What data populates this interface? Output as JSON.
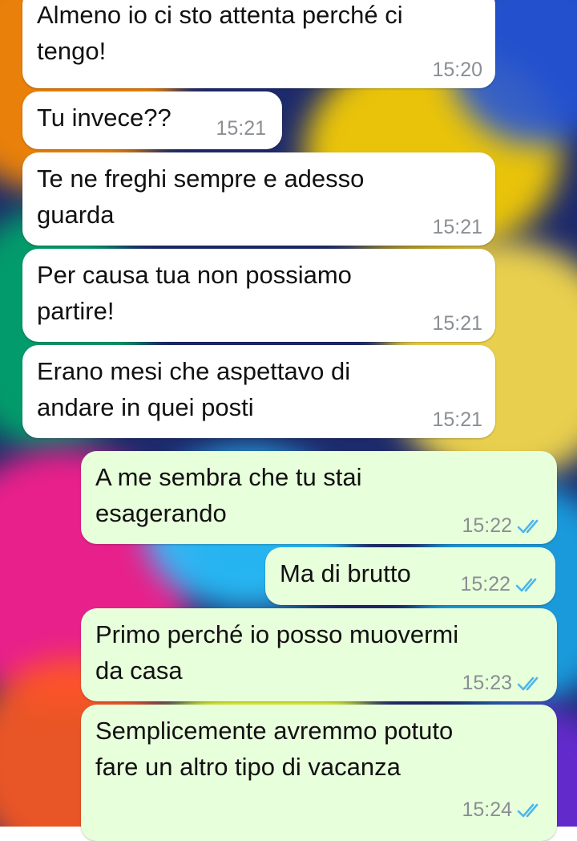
{
  "colors": {
    "incoming_bubble": "#ffffff",
    "outgoing_bubble": "#e7ffdb",
    "read_ticks": "#4fb6ec",
    "timestamp": "#8a8f94"
  },
  "messages": [
    {
      "direction": "in",
      "text": "Almeno io ci sto attenta perché ci\ntengo!",
      "time": "15:20"
    },
    {
      "direction": "in",
      "text": "Tu invece??",
      "time": "15:21"
    },
    {
      "direction": "in",
      "text": "Te ne freghi sempre e adesso\nguarda",
      "time": "15:21"
    },
    {
      "direction": "in",
      "text": "Per causa tua non possiamo\npartire!",
      "time": "15:21"
    },
    {
      "direction": "in",
      "text": "Erano mesi che aspettavo di\nandare in quei posti",
      "time": "15:21"
    },
    {
      "direction": "out",
      "text": "A me sembra che tu stai\nesagerando",
      "time": "15:22",
      "status_icon": "double-check-read-icon"
    },
    {
      "direction": "out",
      "text": "Ma di brutto",
      "time": "15:22",
      "status_icon": "double-check-read-icon"
    },
    {
      "direction": "out",
      "text": "Primo perché io posso muovermi\nda casa",
      "time": "15:23",
      "status_icon": "double-check-read-icon"
    },
    {
      "direction": "out",
      "text": "Semplicemente avremmo potuto\nfare un altro tipo di vacanza",
      "time": "15:24",
      "status_icon": "double-check-read-icon"
    }
  ]
}
